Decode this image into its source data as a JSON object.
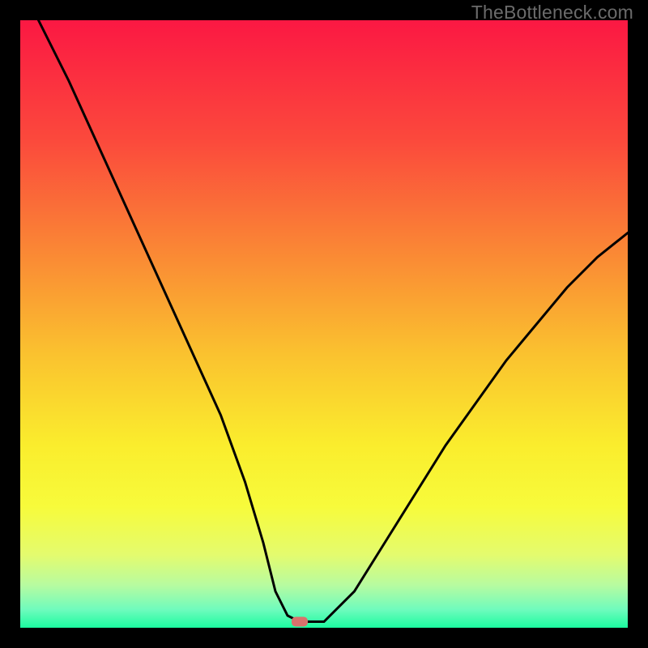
{
  "watermark": "TheBottleneck.com",
  "chart_data": {
    "type": "line",
    "title": "",
    "xlabel": "",
    "ylabel": "",
    "xlim": [
      0,
      100
    ],
    "ylim": [
      0,
      100
    ],
    "background_gradient_note": "vertical heat gradient: red (top) through orange/yellow to green (bottom)",
    "series": [
      {
        "name": "bottleneck-curve",
        "x": [
          3,
          8,
          13,
          18,
          23,
          28,
          33,
          37,
          40,
          42,
          44,
          46,
          50,
          55,
          60,
          65,
          70,
          75,
          80,
          85,
          90,
          95,
          100
        ],
        "y": [
          100,
          90,
          79,
          68,
          57,
          46,
          35,
          24,
          14,
          6,
          2,
          1,
          1,
          6,
          14,
          22,
          30,
          37,
          44,
          50,
          56,
          61,
          65
        ]
      }
    ],
    "marker": {
      "x": 46,
      "y": 1,
      "color": "#d9716c",
      "shape": "rounded-rect"
    }
  },
  "colors": {
    "gradient_stops": [
      {
        "offset": 0.0,
        "color": "#fb1843"
      },
      {
        "offset": 0.2,
        "color": "#fb4a3c"
      },
      {
        "offset": 0.4,
        "color": "#fa8e34"
      },
      {
        "offset": 0.55,
        "color": "#fac22f"
      },
      {
        "offset": 0.7,
        "color": "#faed2d"
      },
      {
        "offset": 0.8,
        "color": "#f7fb3b"
      },
      {
        "offset": 0.88,
        "color": "#e4fb6e"
      },
      {
        "offset": 0.93,
        "color": "#b7fba0"
      },
      {
        "offset": 0.97,
        "color": "#6ffbbd"
      },
      {
        "offset": 1.0,
        "color": "#1bfb9f"
      }
    ],
    "curve": "#000000",
    "marker": "#d9716c"
  }
}
